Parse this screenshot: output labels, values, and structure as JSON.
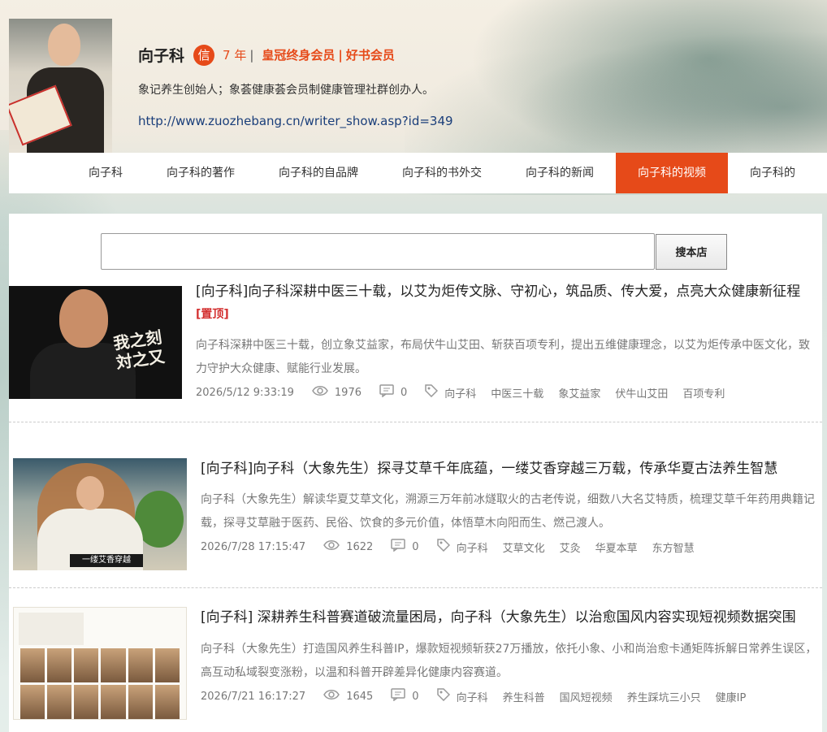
{
  "profile": {
    "name": "向子科",
    "badge": "信",
    "years": "7 年",
    "sep1": "|",
    "member1": "皇冠终身会员",
    "sep2": "|",
    "member2": "好书会员",
    "bio": "象记养生创始人；象荟健康荟会员制健康管理社群创办人。",
    "url": "http://www.zuozhebang.cn/writer_show.asp?id=349"
  },
  "nav": {
    "items": [
      {
        "label": "向子科"
      },
      {
        "label": "向子科的著作"
      },
      {
        "label": "向子科的自品牌"
      },
      {
        "label": "向子科的书外交"
      },
      {
        "label": "向子科的新闻"
      },
      {
        "label": "向子科的视频"
      },
      {
        "label": "向子科的"
      }
    ],
    "active_index": 5
  },
  "search": {
    "placeholder": "",
    "button": "搜本店"
  },
  "articles": [
    {
      "title": "[向子科]向子科深耕中医三十载，以艾为炬传文脉、守初心，筑品质、传大爱，点亮大众健康新征程",
      "pinned": "[置顶]",
      "desc": "向子科深耕中医三十载，创立象艾益家，布局伏牛山艾田、斩获百项专利，提出五维健康理念，以艾为炬传承中医文化，致力守护大众健康、赋能行业发展。",
      "date": "2026/5/12 9:33:19",
      "views": "1976",
      "comments": "0",
      "tags": [
        "向子科",
        "中医三十载",
        "象艾益家",
        "伏牛山艾田",
        "百项专利"
      ],
      "thumb_caption": "我之刻 対之又"
    },
    {
      "title": "[向子科]向子科（大象先生）探寻艾草千年底蕴，一缕艾香穿越三万载，传承华夏古法养生智慧",
      "desc": "向子科（大象先生）解读华夏艾草文化，溯源三万年前冰燧取火的古老传说，细数八大名艾特质，梳理艾草千年药用典籍记载，探寻艾草融于医药、民俗、饮食的多元价值，体悟草木向阳而生、燃己渡人。",
      "date": "2026/7/28 17:15:47",
      "views": "1622",
      "comments": "0",
      "tags": [
        "向子科",
        "艾草文化",
        "艾灸",
        "华夏本草",
        "东方智慧"
      ],
      "thumb_caption": "一缕艾香穿越"
    },
    {
      "title": "[向子科] 深耕养生科普赛道破流量困局，向子科（大象先生）以治愈国风内容实现短视频数据突围",
      "desc": "向子科（大象先生）打造国风养生科普IP，爆款短视频斩获27万播放，依托小象、小和尚治愈卡通矩阵拆解日常养生误区，高互动私域裂变涨粉，以温和科普开辟差异化健康内容赛道。",
      "date": "2026/7/21 16:17:27",
      "views": "1645",
      "comments": "0",
      "tags": [
        "向子科",
        "养生科普",
        "国风短视频",
        "养生踩坑三小只",
        "健康IP"
      ]
    }
  ],
  "colors": {
    "accent": "#e64a19",
    "link": "#1a3e7a",
    "pin": "#d32f2f"
  },
  "icons": [
    "eye-icon",
    "comment-icon",
    "tag-icon",
    "xin-badge"
  ]
}
